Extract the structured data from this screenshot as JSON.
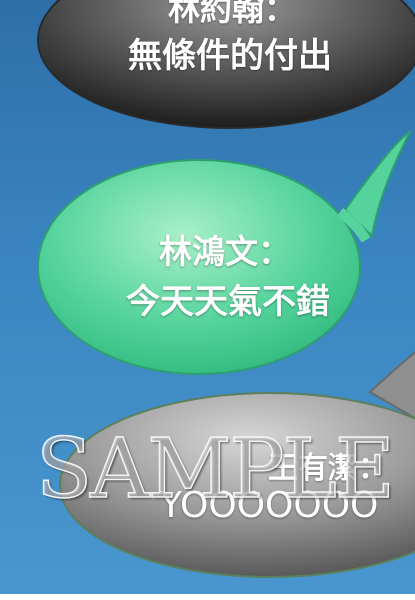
{
  "bubbles": [
    {
      "speaker_line": "林約翰：",
      "message": "無條件的付出"
    },
    {
      "speaker_line": "林鴻文：",
      "message": "今天天氣不錯"
    },
    {
      "speaker_line": "王有潔：",
      "message": "YOOOOOOO"
    }
  ],
  "watermark": "SAMPLE",
  "colors": {
    "background": "#3a86c2",
    "bubble_dark": "#4a4a4a",
    "bubble_green": "#4fd19a",
    "bubble_gray": "#8c8c8c",
    "text": "#ffffff"
  }
}
